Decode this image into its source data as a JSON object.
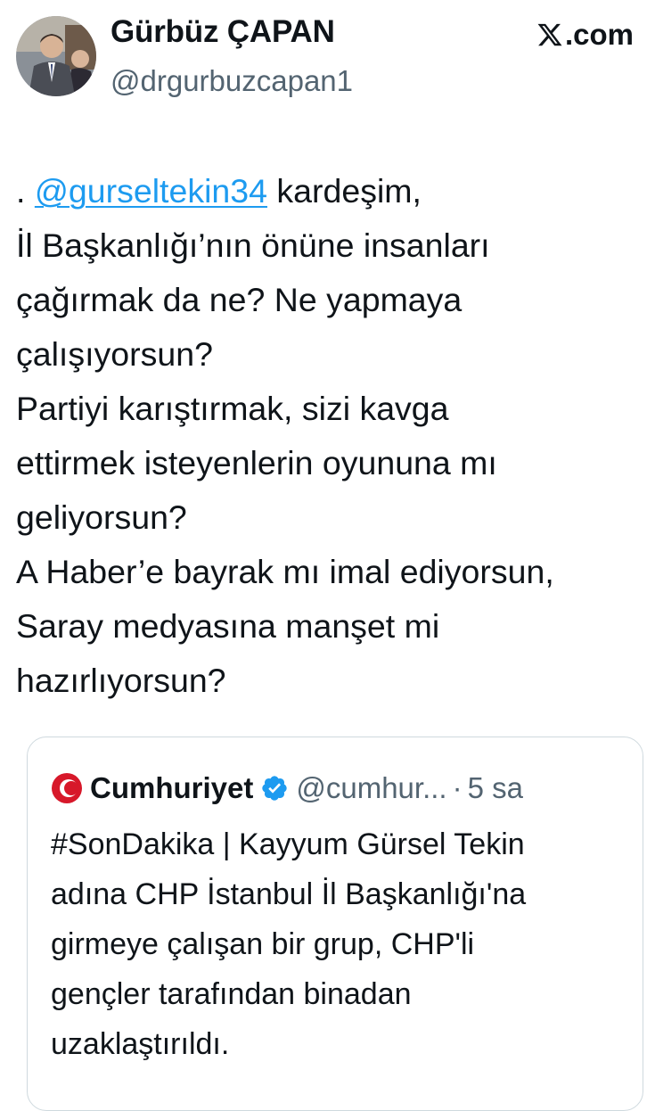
{
  "author": {
    "display_name": "Gürbüz ÇAPAN",
    "handle": "@drgurbuzcapan1",
    "avatar_icon": "profile-photo"
  },
  "brand": {
    "label": ".com",
    "icon": "x-logo-icon"
  },
  "tweet": {
    "prefix": ". ",
    "mention": "@gurseltekin34",
    "line1_rest": " kardeşim,",
    "lines": [
      "İl Başkanlığı’nın önüne insanları",
      "çağırmak da ne? Ne yapmaya",
      "çalışıyorsun?",
      "Partiyi karıştırmak, sizi kavga",
      "ettirmek isteyenlerin oyununa mı",
      "geliyorsun?",
      "A Haber’e bayrak mı imal ediyorsun,",
      "Saray medyasına manşet mi",
      "hazırlıyorsun?"
    ]
  },
  "quoted": {
    "name": "Cumhuriyet",
    "handle": "@cumhur...",
    "separator": "·",
    "time": "5 sa",
    "lines": [
      "#SonDakika | Kayyum Gürsel Tekin",
      "adına CHP İstanbul İl Başkanlığı'na",
      "girmeye çalışan bir grup, CHP'li",
      "gençler tarafından binadan",
      "uzaklaştırıldı."
    ]
  },
  "colors": {
    "text": "#0f1419",
    "secondary": "#536471",
    "link": "#1d9bf0",
    "verified": "#1d9bf0",
    "cumhuriyet_red": "#d7182a",
    "border": "#cfd9de"
  }
}
